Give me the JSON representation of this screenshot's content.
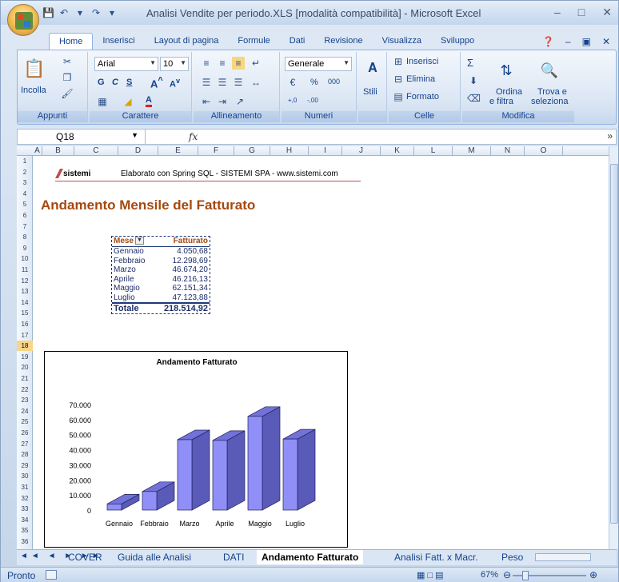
{
  "window": {
    "title": "Analisi Vendite per periodo.XLS  [modalità compatibilità] - Microsoft Excel"
  },
  "tabs": [
    "Home",
    "Inserisci",
    "Layout di pagina",
    "Formule",
    "Dati",
    "Revisione",
    "Visualizza",
    "Sviluppo"
  ],
  "ribbon": {
    "appunti": {
      "label": "Appunti",
      "paste": "Incolla"
    },
    "carattere": {
      "label": "Carattere",
      "font": "Arial",
      "size": "10",
      "bold": "G",
      "italic": "C",
      "underline": "S"
    },
    "allineamento": {
      "label": "Allineamento"
    },
    "numeri": {
      "label": "Numeri",
      "format": "Generale"
    },
    "stili": {
      "label": "Stili"
    },
    "celle": {
      "label": "Celle",
      "insert": "Inserisci",
      "delete": "Elimina",
      "format": "Formato"
    },
    "modifica": {
      "label": "Modifica",
      "sort": "Ordina",
      "sort2": "e filtra",
      "find": "Trova e",
      "find2": "seleziona"
    }
  },
  "formula_bar": {
    "cell_ref": "Q18",
    "fx": "fx",
    "content": ""
  },
  "columns": [
    "A",
    "B",
    "C",
    "D",
    "E",
    "F",
    "G",
    "H",
    "I",
    "J",
    "K",
    "L",
    "M",
    "N",
    "O"
  ],
  "rows": [
    "1",
    "2",
    "3",
    "4",
    "5",
    "6",
    "7",
    "8",
    "9",
    "10",
    "11",
    "12",
    "13",
    "14",
    "15",
    "16",
    "17",
    "18",
    "19",
    "20",
    "21",
    "22",
    "23",
    "24",
    "25",
    "26",
    "27",
    "28",
    "29",
    "30",
    "31",
    "32",
    "33",
    "34",
    "35",
    "36"
  ],
  "sheet": {
    "logo": "sistemi",
    "elaborato": "Elaborato con Spring SQL - SISTEMI SPA - www.sistemi.com",
    "title": "Andamento Mensile del Fatturato",
    "table": {
      "headers": [
        "Mese",
        "Fatturato"
      ],
      "rows": [
        [
          "Gennaio",
          "4.050,68"
        ],
        [
          "Febbraio",
          "12.298,69"
        ],
        [
          "Marzo",
          "46.674,20"
        ],
        [
          "Aprile",
          "46.216,13"
        ],
        [
          "Maggio",
          "62.151,34"
        ],
        [
          "Luglio",
          "47.123,88"
        ]
      ],
      "total_label": "Totale",
      "total_value": "218.514,92"
    }
  },
  "chart_data": {
    "type": "bar",
    "title": "Andamento Fatturato",
    "categories": [
      "Gennaio",
      "Febbraio",
      "Marzo",
      "Aprile",
      "Maggio",
      "Luglio"
    ],
    "values": [
      4050.68,
      12298.69,
      46674.2,
      46216.13,
      62151.34,
      47123.88
    ],
    "yticks": [
      "0",
      "10.000",
      "20.000",
      "30.000",
      "40.000",
      "50.000",
      "60.000",
      "70.000"
    ],
    "ylim": [
      0,
      70000
    ],
    "xlabel": "",
    "ylabel": "",
    "grid": false,
    "style": "3d-column",
    "colors": {
      "front": "#8f8ff7",
      "side": "#5a5ab8",
      "top": "#7272d8"
    }
  },
  "sheet_tabs": [
    "COVER",
    "Guida alle Analisi",
    "DATI",
    "Andamento Fatturato",
    "Analisi Fatt. x Macr.",
    "Peso"
  ],
  "status": {
    "text": "Pronto",
    "zoom": "67%"
  }
}
